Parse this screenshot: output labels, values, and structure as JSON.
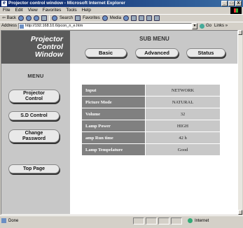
{
  "window": {
    "title": "Projector control window - Microsoft Internet Explorer",
    "controls": [
      "_",
      "□",
      "X"
    ]
  },
  "menubar": [
    "File",
    "Edit",
    "View",
    "Favorites",
    "Tools",
    "Help"
  ],
  "toolbar": {
    "back": "⇦ Back",
    "search": "Search",
    "favorites": "Favorites",
    "media": "Media"
  },
  "address": {
    "label": "Address",
    "url": "http://192.168.10.6/pcon_n_e.htm",
    "go": "Go",
    "links": "Links »"
  },
  "sidebar": {
    "brand_lines": [
      "Projector",
      "Control",
      "Window"
    ],
    "menu_title": "MENU",
    "buttons": [
      {
        "label1": "Projector",
        "label2": "Control"
      },
      {
        "label1": "S.D Control",
        "label2": ""
      },
      {
        "label1": "Change",
        "label2": "Password"
      },
      {
        "label1": "Top Page",
        "label2": ""
      }
    ]
  },
  "main": {
    "submenu_title": "SUB MENU",
    "tabs": [
      "Basic",
      "Advanced",
      "Status"
    ],
    "rows": [
      {
        "key": "Input",
        "value": "NETWORK"
      },
      {
        "key": "Picture Mode",
        "value": "NATURAL"
      },
      {
        "key": "Volume",
        "value": "32"
      },
      {
        "key": "Lamp Power",
        "value": "HIGH"
      },
      {
        "key": "amp Run time",
        "value": "42 h"
      },
      {
        "key": "Lamp Tempelature",
        "value": "Good"
      }
    ]
  },
  "statusbar": {
    "left": "Done",
    "zone": "Internet"
  }
}
